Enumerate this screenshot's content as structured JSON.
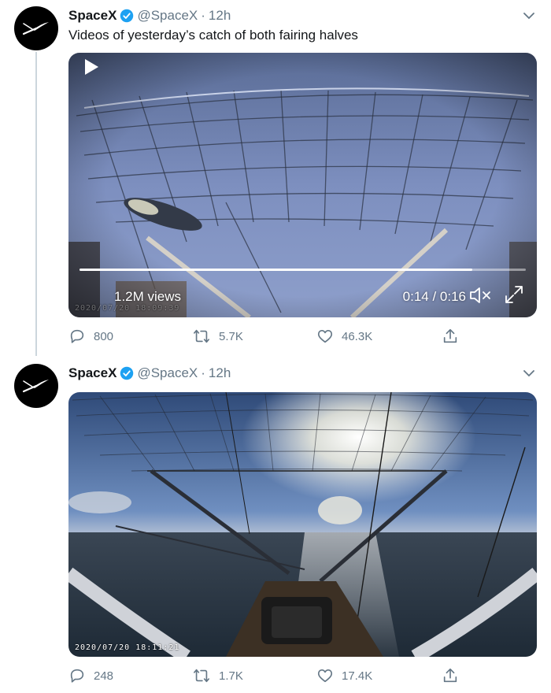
{
  "colors": {
    "brand_blue": "#1da1f2",
    "text_secondary": "#657786",
    "text_primary": "#14171a"
  },
  "tweets": [
    {
      "author_name": "SpaceX",
      "handle": "@SpaceX",
      "separator": "·",
      "time": "12h",
      "text": "Videos of yesterday’s catch of both fairing halves",
      "video": {
        "views": "1.2M views",
        "time": "0:14 / 0:16",
        "progress": 0.88,
        "stamp": "2020/07/20 18:09:39"
      },
      "stats": {
        "replies": "800",
        "retweets": "5.7K",
        "likes": "46.3K"
      }
    },
    {
      "author_name": "SpaceX",
      "handle": "@SpaceX",
      "separator": "·",
      "time": "12h",
      "text": "",
      "video": {
        "stamp": "2020/07/20  18:11:21"
      },
      "stats": {
        "replies": "248",
        "retweets": "1.7K",
        "likes": "17.4K"
      }
    }
  ],
  "icons": [
    "spacex-logo-icon",
    "verified-badge-icon",
    "chevron-down-icon",
    "play-icon",
    "mute-icon",
    "fullscreen-icon",
    "reply-icon",
    "retweet-icon",
    "like-icon",
    "share-icon"
  ]
}
